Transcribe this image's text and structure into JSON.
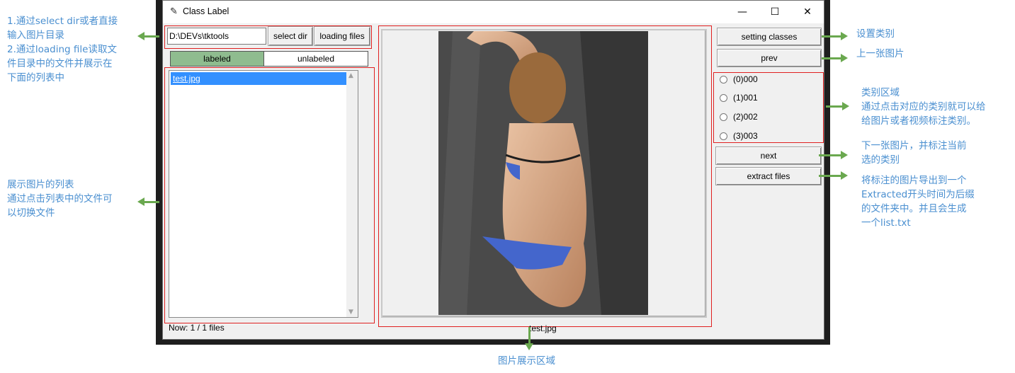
{
  "window": {
    "title": "Class Label",
    "controls": {
      "minimize": "—",
      "maximize": "☐",
      "close": "✕"
    }
  },
  "toolbar": {
    "path_value": "D:\\DEVs\\tktools",
    "select_dir": "select dir",
    "loading_files": "loading files"
  },
  "tabs": {
    "labeled": "labeled",
    "unlabeled": "unlabeled"
  },
  "file_list": {
    "items": [
      "test.jpg"
    ]
  },
  "status": {
    "count": "Now: 1 / 1 files",
    "current_file": "test.jpg"
  },
  "right_panel": {
    "setting_classes": "setting classes",
    "prev": "prev",
    "classes": [
      "(0)000",
      "(1)001",
      "(2)002",
      "(3)003"
    ],
    "next": "next",
    "extract_files": "extract files"
  },
  "annotations": {
    "path_help": "1.通过select dir或者直接\n输入图片目录\n2.通过loading file读取文\n件目录中的文件并展示在\n下面的列表中",
    "list_help": "展示图片的列表\n通过点击列表中的文件可\n以切换文件",
    "image_area": "图片展示区域",
    "setting_classes": "设置类别",
    "prev": "上一张图片",
    "classes_area": "类别区域\n通过点击对应的类别就可以给\n给图片或者视频标注类别。",
    "next": "下一张图片，并标注当前\n选的类别",
    "extract": "将标注的图片导出到一个\nExtracted开头时间为后缀\n的文件夹中。并且会生成\n一个list.txt"
  },
  "colors": {
    "annotation_text": "#4a8fd0",
    "arrow": "#6aa84f",
    "highlight_box": "#e02020",
    "labeled_tab": "#8fbc8f",
    "selection": "#3390ff"
  }
}
